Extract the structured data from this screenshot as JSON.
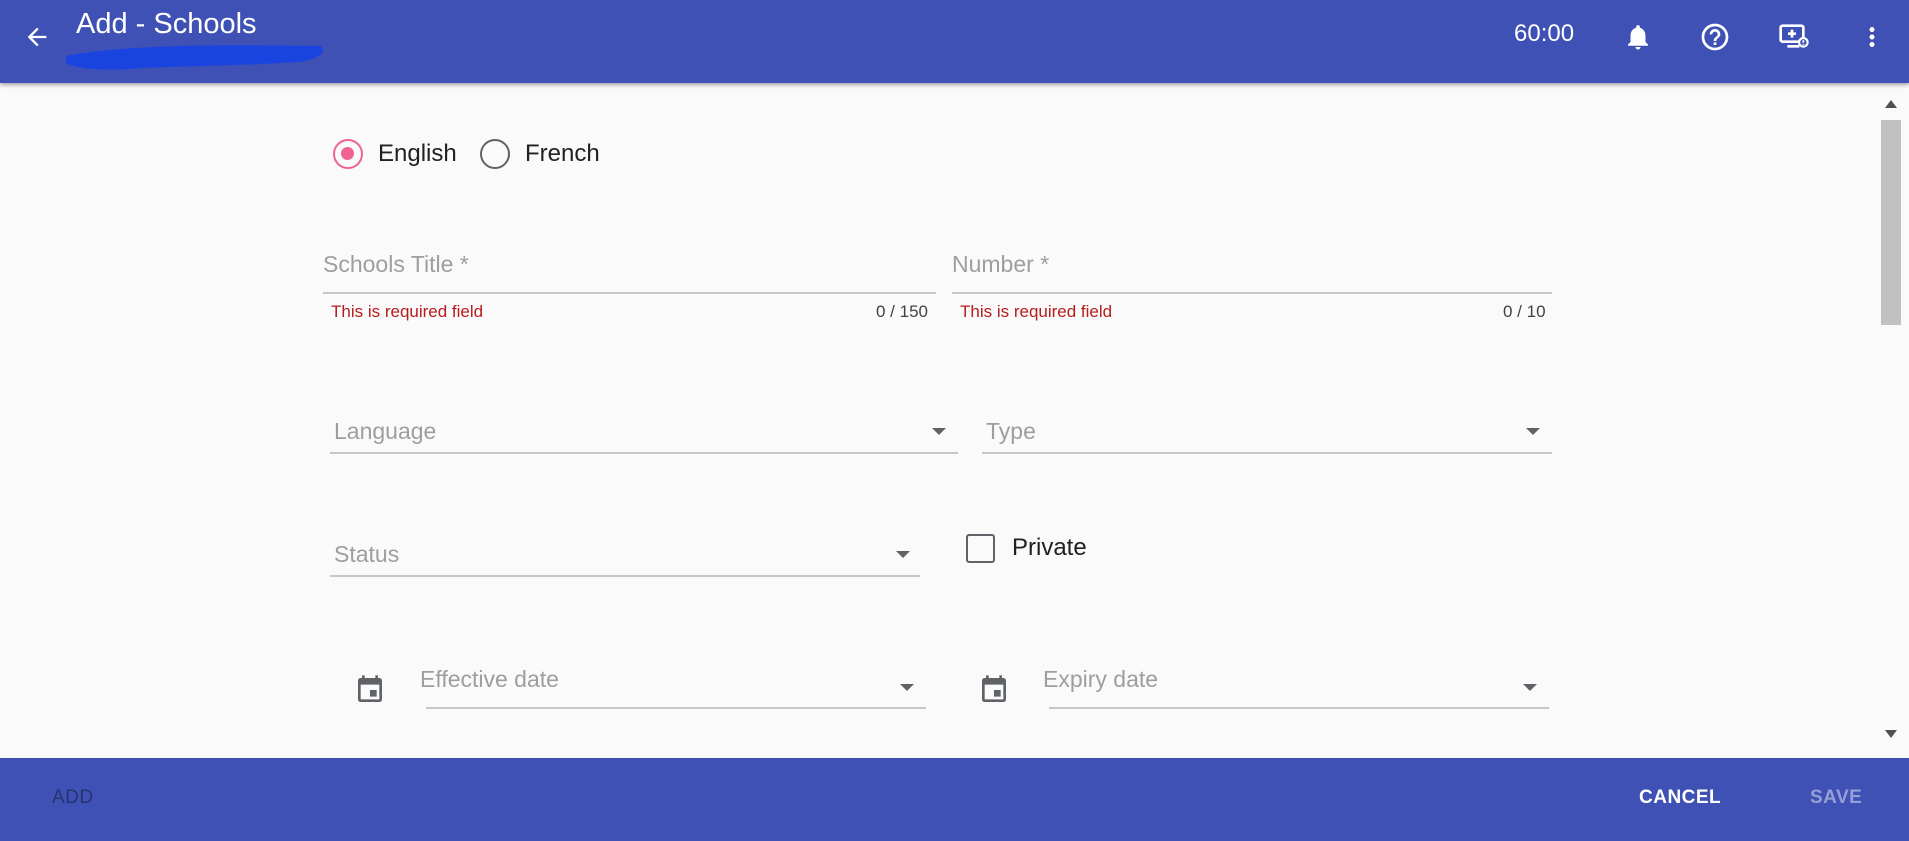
{
  "header": {
    "title": "Add - Schools",
    "timer": "60:00",
    "colors": {
      "bar": "#3f51b5",
      "text": "#ffffff"
    },
    "icons": [
      "arrow-back-icon",
      "bell-icon",
      "help-circle-icon",
      "monitor-add-icon",
      "more-vert-icon"
    ]
  },
  "language_radio": {
    "options": [
      {
        "label": "English",
        "checked": true
      },
      {
        "label": "French",
        "checked": false
      }
    ],
    "accent_color": "#f06292"
  },
  "form": {
    "title_field": {
      "label": "Schools Title *",
      "value": "",
      "error": "This is required field",
      "counter": "0 / 150"
    },
    "number_field": {
      "label": "Number *",
      "value": "",
      "error": "This is required field",
      "counter": "0 / 10"
    },
    "language_select": {
      "label": "Language",
      "value": ""
    },
    "type_select": {
      "label": "Type",
      "value": ""
    },
    "status_select": {
      "label": "Status",
      "value": ""
    },
    "private_checkbox": {
      "label": "Private",
      "checked": false
    },
    "effective_date": {
      "label": "Effective date",
      "value": ""
    },
    "expiry_date": {
      "label": "Expiry date",
      "value": ""
    },
    "error_color": "#b71c1c"
  },
  "footer": {
    "add_label": "ADD",
    "cancel_label": "CANCEL",
    "save_label": "SAVE"
  }
}
